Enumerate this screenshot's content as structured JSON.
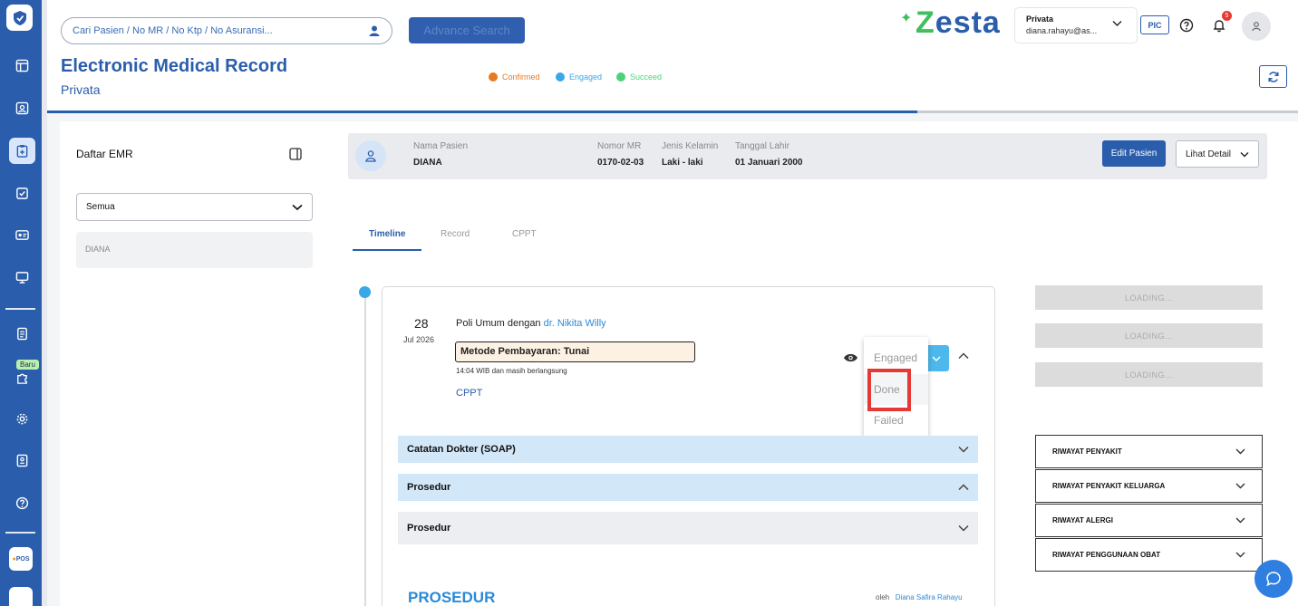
{
  "search": {
    "placeholder": "Cari Pasien / No MR / No Ktp / No Asuransi...",
    "advance_label": "Advance Search"
  },
  "page": {
    "title": "Electronic Medical Record",
    "subtitle": "Privata"
  },
  "legend": [
    {
      "label": "Confirmed",
      "color": "#e97a1f"
    },
    {
      "label": "Engaged",
      "color": "#3aa7e8"
    },
    {
      "label": "Succeed",
      "color": "#4cd37a"
    }
  ],
  "brand": {
    "name": "esta",
    "color": "#2a5dab"
  },
  "account": {
    "name": "Privata",
    "email": "diana.rahayu@as..."
  },
  "header": {
    "pic_label": "PIC",
    "notification_count": "5"
  },
  "sidebar": {
    "new_badge": "Baru",
    "pos_label": "POS"
  },
  "emr": {
    "title": "Daftar EMR",
    "filter_value": "Semua",
    "list": [
      "DIANA"
    ]
  },
  "patient": {
    "name_label": "Nama Pasien",
    "name": "DIANA",
    "mr_label": "Nomor MR",
    "mr": "0170-02-03",
    "gender_label": "Jenis Kelamin",
    "gender": "Laki - laki",
    "dob_label": "Tanggal Lahir",
    "dob": "01 Januari 2000",
    "edit_label": "Edit Pasien",
    "detail_label": "Lihat Detail"
  },
  "tabs": [
    "Timeline",
    "Record",
    "CPPT"
  ],
  "visit": {
    "day": "28",
    "month": "Jul 2026",
    "title_prefix": "Poli Umum dengan ",
    "doctor": "dr. Nikita Willy",
    "payment": "Metode Pembayaran: Tunai",
    "time": "14:04 WIB dan masih berlangsung",
    "cppt_link": "CPPT"
  },
  "status_menu": [
    "Engaged",
    "Done",
    "Failed"
  ],
  "sections": [
    "Catatan Dokter (SOAP)",
    "Prosedur",
    "Prosedur"
  ],
  "prosedur": {
    "heading": "PROSEDUR",
    "by_label": "oleh",
    "by_name": "Diana Safira Rahayu"
  },
  "loading_label": "LOADING...",
  "history": [
    "RIWAYAT PENYAKIT",
    "RIWAYAT PENYAKIT KELUARGA",
    "RIWAYAT ALERGI",
    "RIWAYAT PENGGUNAAN OBAT"
  ]
}
